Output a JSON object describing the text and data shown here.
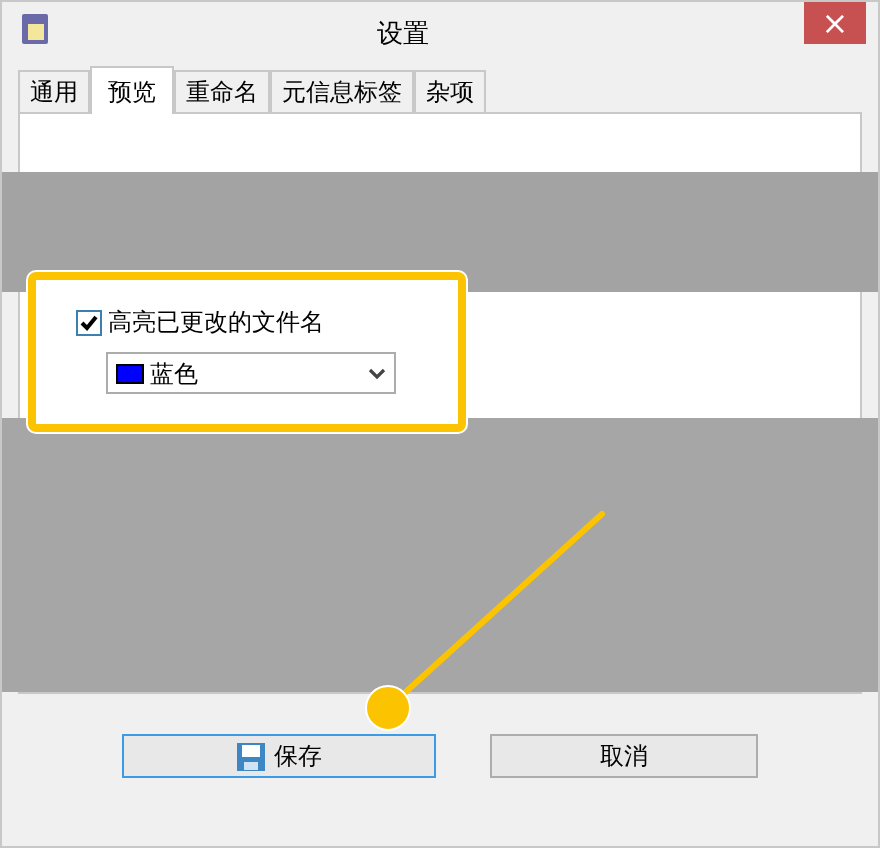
{
  "window": {
    "title": "设置",
    "close": "×"
  },
  "tabs": [
    {
      "label": "通用",
      "selected": false
    },
    {
      "label": "预览",
      "selected": true
    },
    {
      "label": "重命名",
      "selected": false
    },
    {
      "label": "元信息标签",
      "selected": false
    },
    {
      "label": "杂项",
      "selected": false
    }
  ],
  "highlight_option": {
    "label": "高亮已更改的文件名",
    "checked": true
  },
  "color_dropdown": {
    "value": "蓝色",
    "color": "#0000ff"
  },
  "buttons": [
    {
      "label": "保存",
      "kind": "save",
      "focused": true
    },
    {
      "label": "取消",
      "kind": "cancel",
      "focused": false
    }
  ]
}
